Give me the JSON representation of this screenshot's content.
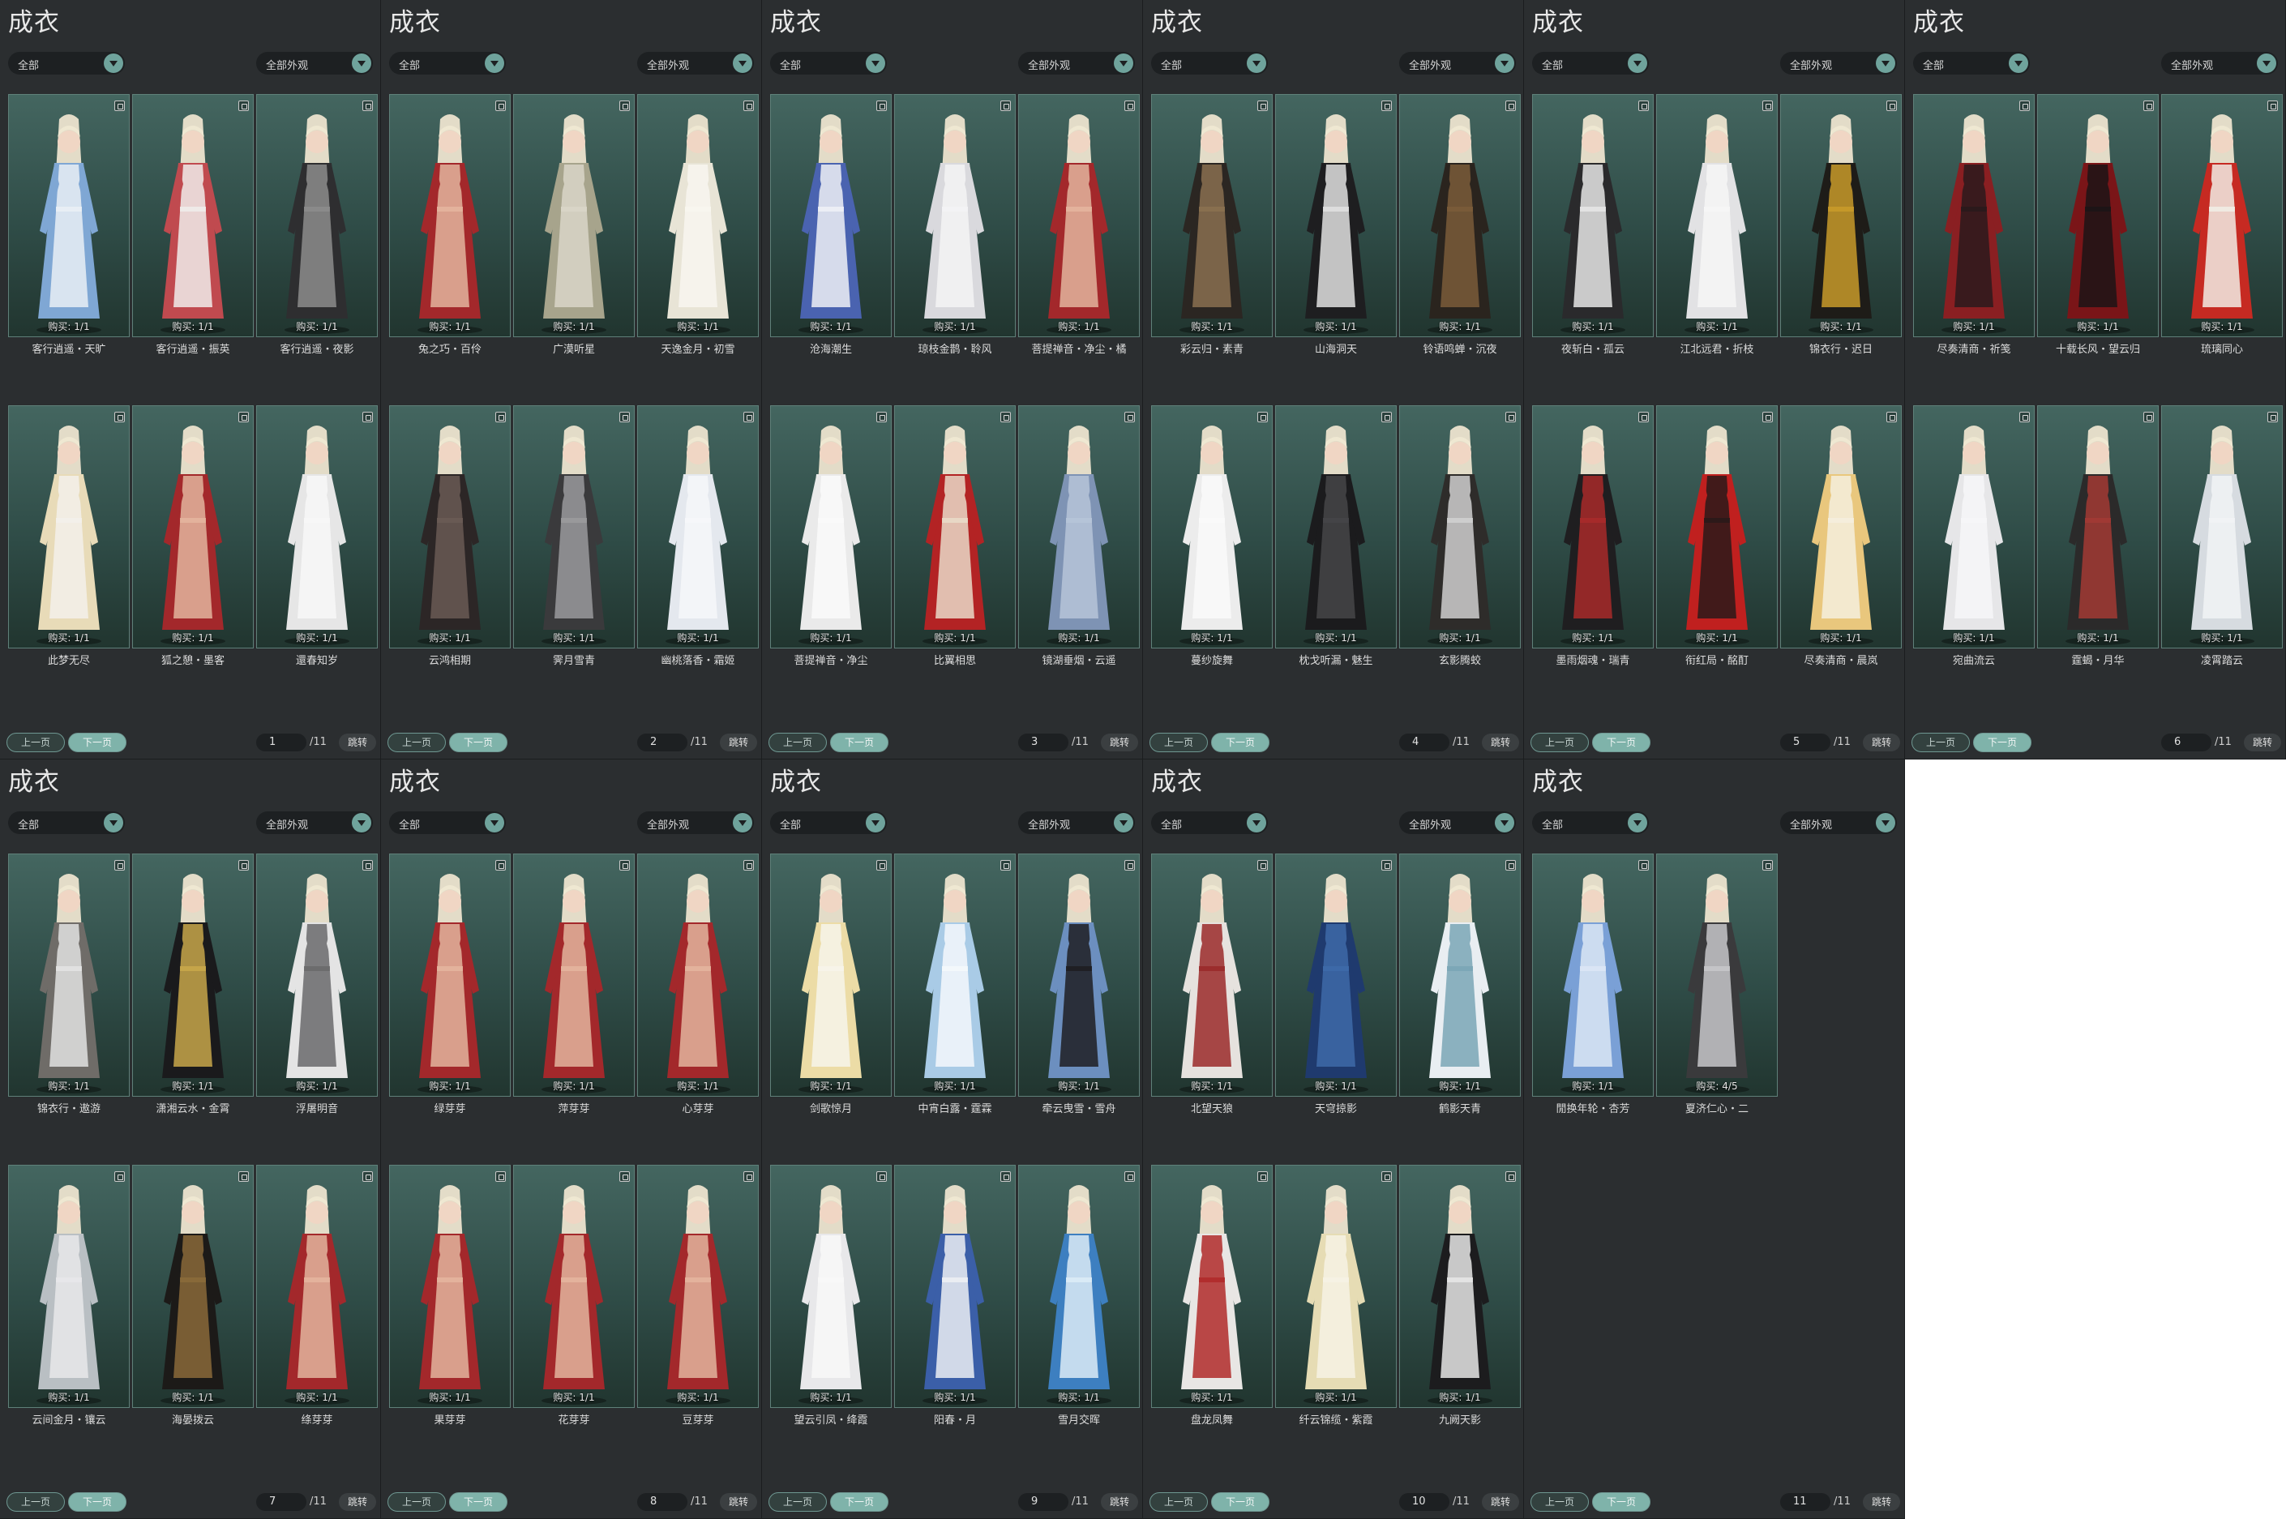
{
  "title": "成衣",
  "filter_type": "全部",
  "filter_look": "全部外观",
  "prev_label": "上一页",
  "next_label": "下一页",
  "jump_label": "跳转",
  "total_pages": "/11",
  "colors": {
    "panel_bg": "#2b2e30",
    "card_bg": "#3b5a55",
    "accent": "#7fb3aa"
  },
  "pages": [
    {
      "page": "1",
      "items": [
        {
          "name": "客行逍遥・天旷",
          "buy": "购买: 1/1",
          "palette": [
            "#7fa7d4",
            "#e9eef5"
          ]
        },
        {
          "name": "客行逍遥・振英",
          "buy": "购买: 1/1",
          "palette": [
            "#c04a4f",
            "#f0ecea"
          ]
        },
        {
          "name": "客行逍遥・夜影",
          "buy": "购买: 1/1",
          "palette": [
            "#2e2e30",
            "#8c8c8c"
          ]
        },
        {
          "name": "此梦无尽",
          "buy": "购买: 1/1",
          "palette": [
            "#e8dbb8",
            "#f3f0ea"
          ]
        },
        {
          "name": "狐之憩・墨客",
          "buy": "购买: 1/1",
          "palette": [
            "#a3282b",
            "#e3b49d"
          ]
        },
        {
          "name": "還春知岁",
          "buy": "购买: 1/1",
          "palette": [
            "#e6e6e6",
            "#f7f7f7"
          ]
        }
      ]
    },
    {
      "page": "2",
      "items": [
        {
          "name": "兔之巧・百伶",
          "buy": "购买: 1/1",
          "palette": [
            "#a3282b",
            "#e3b49d"
          ]
        },
        {
          "name": "广漠听星",
          "buy": "购买: 1/1",
          "palette": [
            "#a7a48c",
            "#d9d6c8"
          ]
        },
        {
          "name": "天逸金月・初雪",
          "buy": "购买: 1/1",
          "palette": [
            "#e8e4d6",
            "#f8f6f0"
          ]
        },
        {
          "name": "云鸿相期",
          "buy": "购买: 1/1",
          "palette": [
            "#2c2626",
            "#6a5b55"
          ]
        },
        {
          "name": "霁月雪青",
          "buy": "购买: 1/1",
          "palette": [
            "#3a3a3c",
            "#9a9a9c"
          ]
        },
        {
          "name": "幽桃落香・霜姬",
          "buy": "购买: 1/1",
          "palette": [
            "#e4e8ee",
            "#f6f7f9"
          ]
        }
      ]
    },
    {
      "page": "3",
      "items": [
        {
          "name": "沧海潮生",
          "buy": "购买: 1/1",
          "palette": [
            "#4a63b0",
            "#eef0f6"
          ]
        },
        {
          "name": "琼枝金鹊・聆风",
          "buy": "购买: 1/1",
          "palette": [
            "#d9d9dd",
            "#f3f3f5"
          ]
        },
        {
          "name": "菩提禅音・净尘・橘",
          "buy": "购买: 1/1",
          "palette": [
            "#a3282b",
            "#e3b49d"
          ]
        },
        {
          "name": "菩提禅音・净尘",
          "buy": "购买: 1/1",
          "palette": [
            "#eaeaea",
            "#fafafa"
          ]
        },
        {
          "name": "比翼相思",
          "buy": "购买: 1/1",
          "palette": [
            "#b32324",
            "#e9d9c8"
          ]
        },
        {
          "name": "镜湖垂烟・云遥",
          "buy": "购买: 1/1",
          "palette": [
            "#7e93b4",
            "#b6c4d8"
          ]
        }
      ]
    },
    {
      "page": "4",
      "items": [
        {
          "name": "彩云归・素青",
          "buy": "购买: 1/1",
          "palette": [
            "#2b2622",
            "#8a7050"
          ]
        },
        {
          "name": "山海洞天",
          "buy": "购买: 1/1",
          "palette": [
            "#1e1e20",
            "#e0e0e0"
          ]
        },
        {
          "name": "铃语鸣蝉・沉夜",
          "buy": "购买: 1/1",
          "palette": [
            "#2a241e",
            "#7a5c3a"
          ]
        },
        {
          "name": "蔓纱旋舞",
          "buy": "购买: 1/1",
          "palette": [
            "#ececec",
            "#fafafa"
          ]
        },
        {
          "name": "枕戈听漏・魅生",
          "buy": "购买: 1/1",
          "palette": [
            "#1b1b1d",
            "#454548"
          ]
        },
        {
          "name": "玄影腾蛟",
          "buy": "购买: 1/1",
          "palette": [
            "#2e2c2a",
            "#cfcfcf"
          ]
        }
      ]
    },
    {
      "page": "5",
      "items": [
        {
          "name": "夜斩白・孤云",
          "buy": "购买: 1/1",
          "palette": [
            "#2a2a2c",
            "#e6e6e6"
          ]
        },
        {
          "name": "江北远君・折枝",
          "buy": "购买: 1/1",
          "palette": [
            "#e2e2e4",
            "#f6f6f6"
          ]
        },
        {
          "name": "锦衣行・迟日",
          "buy": "购买: 1/1",
          "palette": [
            "#1e1c18",
            "#c89a2a"
          ]
        },
        {
          "name": "墨雨烟魂・瑞青",
          "buy": "购买: 1/1",
          "palette": [
            "#1f1e20",
            "#a82a2a"
          ]
        },
        {
          "name": "衔红局・酩酊",
          "buy": "购买: 1/1",
          "palette": [
            "#c0201f",
            "#2a1a1a"
          ]
        },
        {
          "name": "尽奏清商・晨岚",
          "buy": "购买: 1/1",
          "palette": [
            "#e9c77d",
            "#f5eedd"
          ]
        }
      ]
    },
    {
      "page": "6",
      "items": [
        {
          "name": "尽奏清商・祈笺",
          "buy": "购买: 1/1",
          "palette": [
            "#8a1f22",
            "#2a1a1c"
          ]
        },
        {
          "name": "十载长风・望云归",
          "buy": "购买: 1/1",
          "palette": [
            "#7a1518",
            "#1c1416"
          ]
        },
        {
          "name": "琉璃同心",
          "buy": "购买: 1/1",
          "palette": [
            "#c62a22",
            "#f1ece4"
          ]
        },
        {
          "name": "宛曲流云",
          "buy": "购买: 1/1",
          "palette": [
            "#e6e6e8",
            "#f6f6f8"
          ]
        },
        {
          "name": "霆蝎・月华",
          "buy": "购买: 1/1",
          "palette": [
            "#2b2a2a",
            "#a23a34"
          ]
        },
        {
          "name": "凌霄踏云",
          "buy": "购买: 1/1",
          "palette": [
            "#d6dbe0",
            "#f1f3f5"
          ]
        }
      ]
    },
    {
      "page": "7",
      "items": [
        {
          "name": "锦衣行・遨游",
          "buy": "购买: 1/1",
          "palette": [
            "#6f6c68",
            "#e2e2e2"
          ]
        },
        {
          "name": "潇湘云水・金霄",
          "buy": "购买: 1/1",
          "palette": [
            "#1a1a1c",
            "#c8a74a"
          ]
        },
        {
          "name": "浮屠明音",
          "buy": "购买: 1/1",
          "palette": [
            "#e4e4e4",
            "#6a6a6c"
          ]
        },
        {
          "name": "云间金月・镶云",
          "buy": "购买: 1/1",
          "palette": [
            "#b9bfc3",
            "#e8e8ea"
          ]
        },
        {
          "name": "海晏拨云",
          "buy": "购买: 1/1",
          "palette": [
            "#1c1a18",
            "#8a6a3a"
          ]
        },
        {
          "name": "绦芽芽",
          "buy": "购买: 1/1",
          "palette": [
            "#a3282b",
            "#e3b49d"
          ]
        }
      ]
    },
    {
      "page": "8",
      "items": [
        {
          "name": "绿芽芽",
          "buy": "购买: 1/1",
          "palette": [
            "#a3282b",
            "#e3b49d"
          ]
        },
        {
          "name": "萍芽芽",
          "buy": "购买: 1/1",
          "palette": [
            "#a3282b",
            "#e3b49d"
          ]
        },
        {
          "name": "心芽芽",
          "buy": "购买: 1/1",
          "palette": [
            "#a3282b",
            "#e3b49d"
          ]
        },
        {
          "name": "果芽芽",
          "buy": "购买: 1/1",
          "palette": [
            "#a3282b",
            "#e3b49d"
          ]
        },
        {
          "name": "花芽芽",
          "buy": "购买: 1/1",
          "palette": [
            "#a3282b",
            "#e3b49d"
          ]
        },
        {
          "name": "豆芽芽",
          "buy": "购买: 1/1",
          "palette": [
            "#a3282b",
            "#e3b49d"
          ]
        }
      ]
    },
    {
      "page": "9",
      "items": [
        {
          "name": "剑歌惊月",
          "buy": "购买: 1/1",
          "palette": [
            "#ecdca6",
            "#f7f4ea"
          ]
        },
        {
          "name": "中宵白露・霆霖",
          "buy": "购买: 1/1",
          "palette": [
            "#a9cbe6",
            "#f4f8fb"
          ]
        },
        {
          "name": "牵云曳雪・雪舟",
          "buy": "购买: 1/1",
          "palette": [
            "#6c8fbf",
            "#1e1e22"
          ]
        },
        {
          "name": "望云引凤・绛霞",
          "buy": "购买: 1/1",
          "palette": [
            "#e8e8ea",
            "#f8f8f8"
          ]
        },
        {
          "name": "阳春・月",
          "buy": "购买: 1/1",
          "palette": [
            "#3b5fa8",
            "#eceef3"
          ]
        },
        {
          "name": "雪月交晖",
          "buy": "购买: 1/1",
          "palette": [
            "#3d7fc0",
            "#dcebf6"
          ]
        }
      ]
    },
    {
      "page": "10",
      "items": [
        {
          "name": "北望天狼",
          "buy": "购买: 1/1",
          "palette": [
            "#e6e2de",
            "#9a2a2a"
          ]
        },
        {
          "name": "天穹掠影",
          "buy": "购买: 1/1",
          "palette": [
            "#1f3a6e",
            "#3e6aa8"
          ]
        },
        {
          "name": "鹤影天青",
          "buy": "购买: 1/1",
          "palette": [
            "#e9eef2",
            "#7aa6b6"
          ]
        },
        {
          "name": "盘龙凤舞",
          "buy": "购买: 1/1",
          "palette": [
            "#e8e6e4",
            "#b02a2a"
          ]
        },
        {
          "name": "纤云锦缆・紫霞",
          "buy": "购买: 1/1",
          "palette": [
            "#e6dcb4",
            "#f6f2e4"
          ]
        },
        {
          "name": "九阙天影",
          "buy": "购买: 1/1",
          "palette": [
            "#1c1c1e",
            "#e6e6e6"
          ]
        }
      ]
    },
    {
      "page": "11",
      "items": [
        {
          "name": "閒换年轮・杏芳",
          "buy": "购买: 1/1",
          "palette": [
            "#7aa0d6",
            "#dbe6f5"
          ]
        },
        {
          "name": "夏济仁心・二",
          "buy": "购买: 4/5",
          "palette": [
            "#3a3a3c",
            "#c7c7c9"
          ]
        }
      ]
    }
  ]
}
